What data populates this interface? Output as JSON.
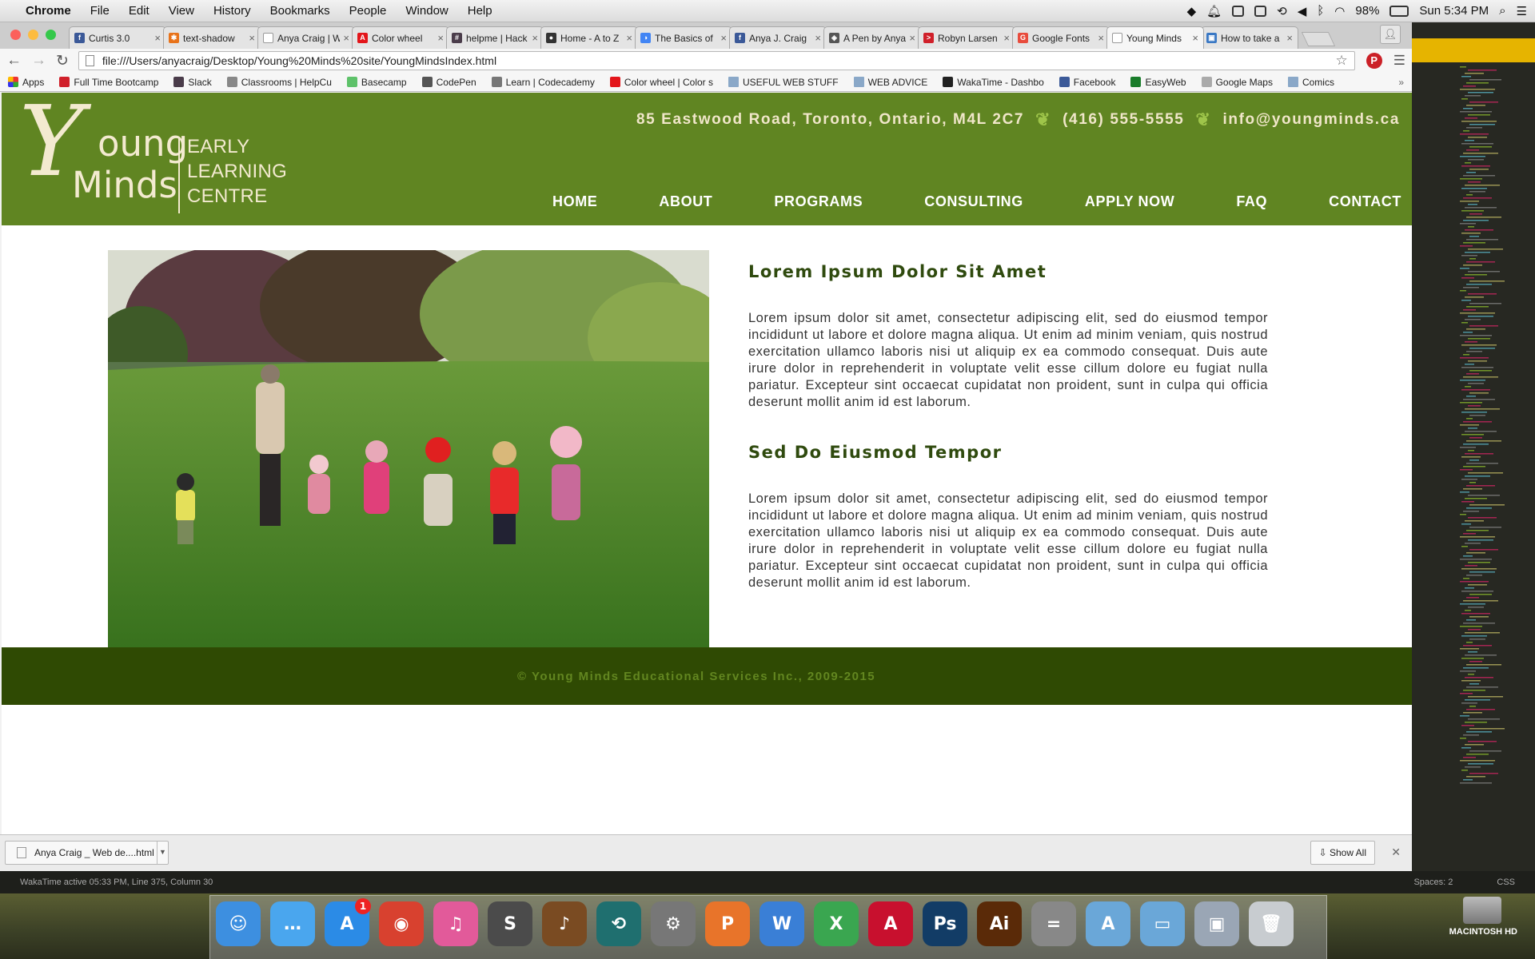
{
  "menubar": {
    "app": "Chrome",
    "items": [
      "File",
      "Edit",
      "View",
      "History",
      "Bookmarks",
      "People",
      "Window",
      "Help"
    ],
    "battery": "98%",
    "clock": "Sun 5:34 PM"
  },
  "tabs": [
    {
      "title": "Curtis 3.0",
      "fav": "f",
      "color": "#3b5998"
    },
    {
      "title": "text-shadow",
      "fav": "✱",
      "color": "#e8731a"
    },
    {
      "title": "Anya Craig | W",
      "fav": "",
      "color": "#ffffff"
    },
    {
      "title": "Color wheel",
      "fav": "A",
      "color": "#e3151a"
    },
    {
      "title": "helpme | Hack",
      "fav": "#",
      "color": "#4a3c4a"
    },
    {
      "title": "Home - A to Z",
      "fav": "●",
      "color": "#333333"
    },
    {
      "title": "The Basics of",
      "fav": "◑",
      "color": "#4285f4"
    },
    {
      "title": "Anya J. Craig",
      "fav": "f",
      "color": "#3b5998"
    },
    {
      "title": "A Pen by Anya",
      "fav": "◈",
      "color": "#555555"
    },
    {
      "title": "Robyn Larsen",
      "fav": ">",
      "color": "#d0202a"
    },
    {
      "title": "Google Fonts",
      "fav": "G",
      "color": "#e84c3d"
    },
    {
      "title": "Young Minds",
      "fav": "",
      "color": "#ffffff",
      "active": true
    },
    {
      "title": "How to take a",
      "fav": "▣",
      "color": "#3a78c4"
    }
  ],
  "toolbar": {
    "url": "file:///Users/anyacraig/Desktop/Young%20Minds%20site/YoungMindsIndex.html"
  },
  "bookmarks": [
    {
      "label": "Apps",
      "type": "apps"
    },
    {
      "label": "Full Time Bootcamp",
      "type": "icon",
      "color": "#d0202a"
    },
    {
      "label": "Slack",
      "type": "icon",
      "color": "#4a3c4a"
    },
    {
      "label": "Classrooms | HelpCu",
      "type": "icon",
      "color": "#888888"
    },
    {
      "label": "Basecamp",
      "type": "icon",
      "color": "#5ec26a"
    },
    {
      "label": "CodePen",
      "type": "icon",
      "color": "#555555"
    },
    {
      "label": "Learn | Codecademy",
      "type": "icon",
      "color": "#777777"
    },
    {
      "label": "Color wheel | Color s",
      "type": "icon",
      "color": "#e3151a"
    },
    {
      "label": "USEFUL WEB STUFF",
      "type": "folder"
    },
    {
      "label": "WEB ADVICE",
      "type": "folder"
    },
    {
      "label": "WakaTime - Dashbo",
      "type": "icon",
      "color": "#222222"
    },
    {
      "label": "Facebook",
      "type": "icon",
      "color": "#3b5998"
    },
    {
      "label": "EasyWeb",
      "type": "icon",
      "color": "#1a7d2b"
    },
    {
      "label": "Google Maps",
      "type": "icon",
      "color": "#aaaaaa"
    },
    {
      "label": "Comics",
      "type": "folder"
    }
  ],
  "site": {
    "logo_letter": "Y",
    "logo_word1": "oung",
    "logo_word2": "Minds",
    "logo_sub": [
      "EARLY",
      "LEARNING",
      "CENTRE"
    ],
    "address": "85 Eastwood Road, Toronto, Ontario, M4L 2C7",
    "phone": "(416) 555-5555",
    "email": "info@youngminds.ca",
    "nav": [
      "HOME",
      "ABOUT",
      "PROGRAMS",
      "CONSULTING",
      "APPLY NOW",
      "FAQ",
      "CONTACT"
    ],
    "sections": [
      {
        "heading": "Lorem Ipsum Dolor Sit Amet",
        "body": "Lorem ipsum dolor sit amet, consectetur adipiscing elit, sed do eiusmod tempor incididunt ut labore et dolore magna aliqua. Ut enim ad minim veniam, quis nostrud exercitation ullamco laboris nisi ut aliquip ex ea commodo consequat. Duis aute irure dolor in reprehenderit in voluptate velit esse cillum dolore eu fugiat nulla pariatur. Excepteur sint occaecat cupidatat non proident, sunt in culpa qui officia deserunt mollit anim id est laborum."
      },
      {
        "heading": "Sed Do Eiusmod Tempor",
        "body": "Lorem ipsum dolor sit amet, consectetur adipiscing elit, sed do eiusmod tempor incididunt ut labore et dolore magna aliqua. Ut enim ad minim veniam, quis nostrud exercitation ullamco laboris nisi ut aliquip ex ea commodo consequat. Duis aute irure dolor in reprehenderit in voluptate velit esse cillum dolore eu fugiat nulla pariatur. Excepteur sint occaecat cupidatat non proident, sunt in culpa qui officia deserunt mollit anim id est laborum."
      }
    ],
    "footer": "© Young Minds Educational Services Inc., 2009-2015"
  },
  "downloads": {
    "file": "Anya Craig _ Web de....html",
    "show_all": "Show All"
  },
  "statusbar": {
    "left": "WakaTime active 05:33 PM, Line 375, Column 30",
    "spaces": "Spaces: 2",
    "syntax": "CSS"
  },
  "dock": [
    {
      "name": "finder",
      "color": "#3d8fe0",
      "glyph": "☺"
    },
    {
      "name": "messages",
      "color": "#4aa6ee",
      "glyph": "…"
    },
    {
      "name": "app-store",
      "color": "#2b8be6",
      "glyph": "A",
      "badge": "1"
    },
    {
      "name": "chrome",
      "color": "#d8412f",
      "glyph": "◉"
    },
    {
      "name": "itunes",
      "color": "#e25a9a",
      "glyph": "♫"
    },
    {
      "name": "sublime-text",
      "color": "#4b4b4b",
      "glyph": "S"
    },
    {
      "name": "garageband",
      "color": "#7a4b22",
      "glyph": "♪"
    },
    {
      "name": "time-machine",
      "color": "#1f6f6f",
      "glyph": "⟲"
    },
    {
      "name": "system-preferences",
      "color": "#777777",
      "glyph": "⚙"
    },
    {
      "name": "powerpoint",
      "color": "#e8742a",
      "glyph": "P"
    },
    {
      "name": "word",
      "color": "#3a7fd6",
      "glyph": "W"
    },
    {
      "name": "excel",
      "color": "#3aa650",
      "glyph": "X"
    },
    {
      "name": "acrobat",
      "color": "#c8102e",
      "glyph": "A"
    },
    {
      "name": "photoshop",
      "color": "#123c66",
      "glyph": "Ps"
    },
    {
      "name": "illustrator",
      "color": "#5a2a08",
      "glyph": "Ai"
    },
    {
      "name": "calculator",
      "color": "#888888",
      "glyph": "="
    },
    {
      "name": "applications-folder",
      "color": "#6aa7d8",
      "glyph": "A"
    },
    {
      "name": "documents-folder",
      "color": "#6aa7d8",
      "glyph": "▭"
    },
    {
      "name": "preview",
      "color": "#9aa6b5",
      "glyph": "▣"
    },
    {
      "name": "trash",
      "color": "#c8ccd0",
      "glyph": "🗑"
    }
  ],
  "hd_label": "MACINTOSH HD",
  "colors": {
    "header_green": "#608522",
    "footer_green": "#2f4a03",
    "heading_green": "#2f4a0e",
    "cream": "#f3ead0"
  }
}
